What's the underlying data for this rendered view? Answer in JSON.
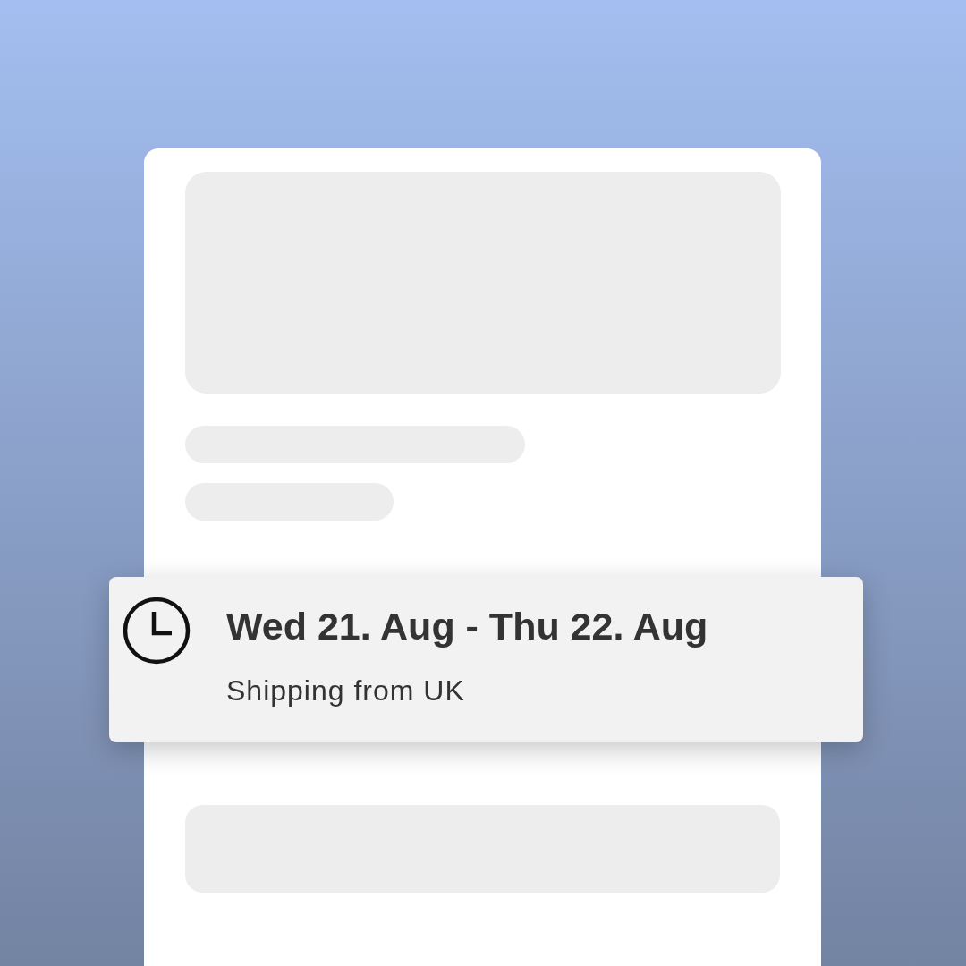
{
  "delivery": {
    "date_range": "Wed 21. Aug - Thu 22. Aug",
    "note": "Shipping from UK"
  }
}
